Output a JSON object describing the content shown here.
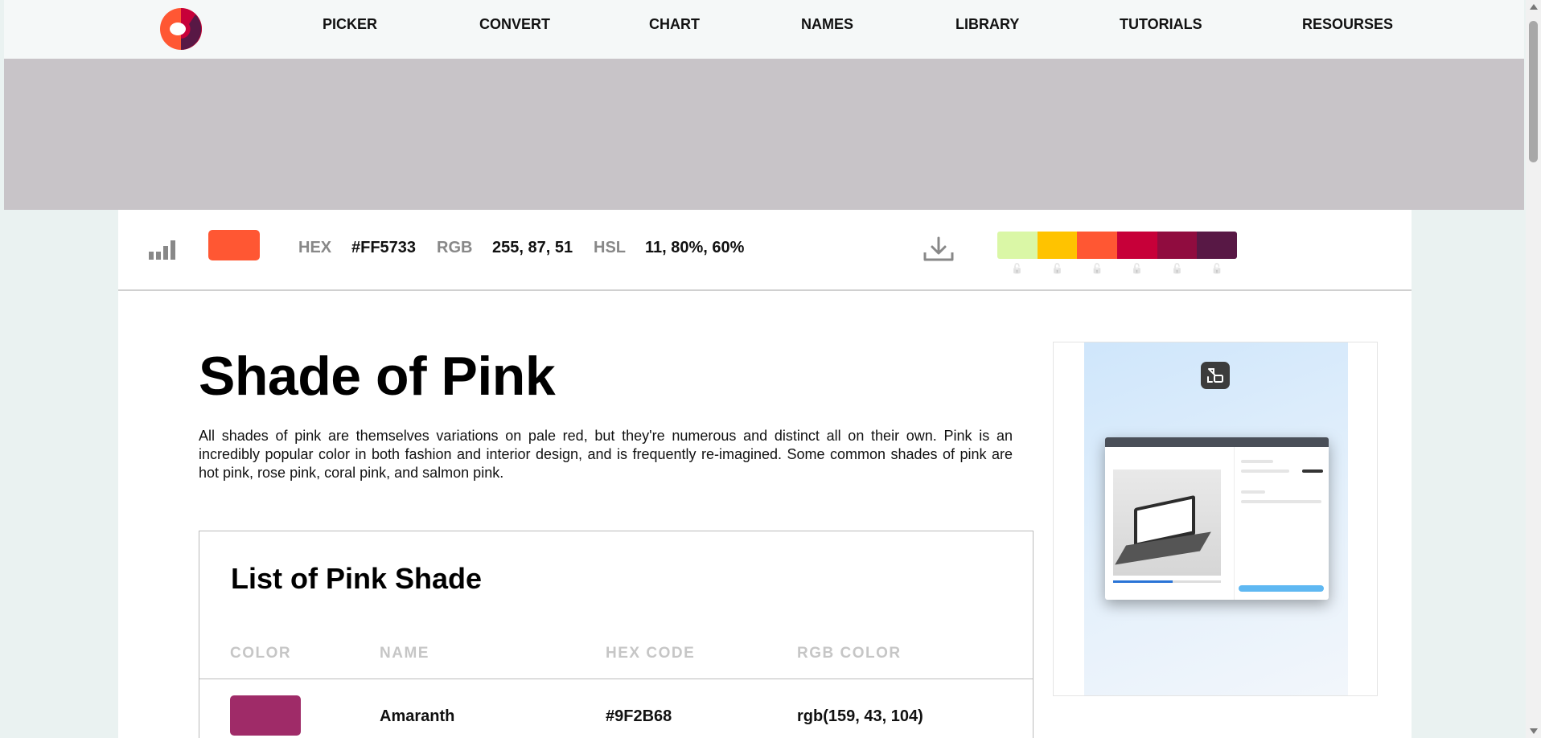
{
  "nav": {
    "items": [
      "PICKER",
      "CONVERT",
      "CHART",
      "NAMES",
      "LIBRARY",
      "TUTORIALS",
      "RESOURSES"
    ]
  },
  "color_bar": {
    "current_color": "#FF5733",
    "hex_label": "HEX",
    "hex_value": "#FF5733",
    "rgb_label": "RGB",
    "rgb_value": "255, 87, 51",
    "hsl_label": "HSL",
    "hsl_value": "11, 80%, 60%",
    "palette": [
      "#DAF7A6",
      "#FFC300",
      "#FF5733",
      "#C70039",
      "#900C3F",
      "#581845"
    ],
    "icons": [
      "bar-chart-icon",
      "download-icon",
      "lock-icon"
    ]
  },
  "content": {
    "title": "Shade of Pink",
    "intro": "All shades of pink are themselves variations on pale red, but they're numerous and distinct all on their own. Pink is an incredibly popular color in both fashion and interior design, and is frequently re-imagined. Some common shades of pink are hot pink, rose pink, coral pink, and salmon pink."
  },
  "shade_list": {
    "title": "List of Pink Shade",
    "columns": [
      "COLOR",
      "NAME",
      "HEX CODE",
      "RGB COLOR"
    ],
    "rows": [
      {
        "color": "#9F2B68",
        "name": "Amaranth",
        "hex": "#9F2B68",
        "rgb": "rgb(159, 43, 104)"
      }
    ]
  },
  "side_ad": {
    "icons": [
      "expand-icon"
    ]
  }
}
